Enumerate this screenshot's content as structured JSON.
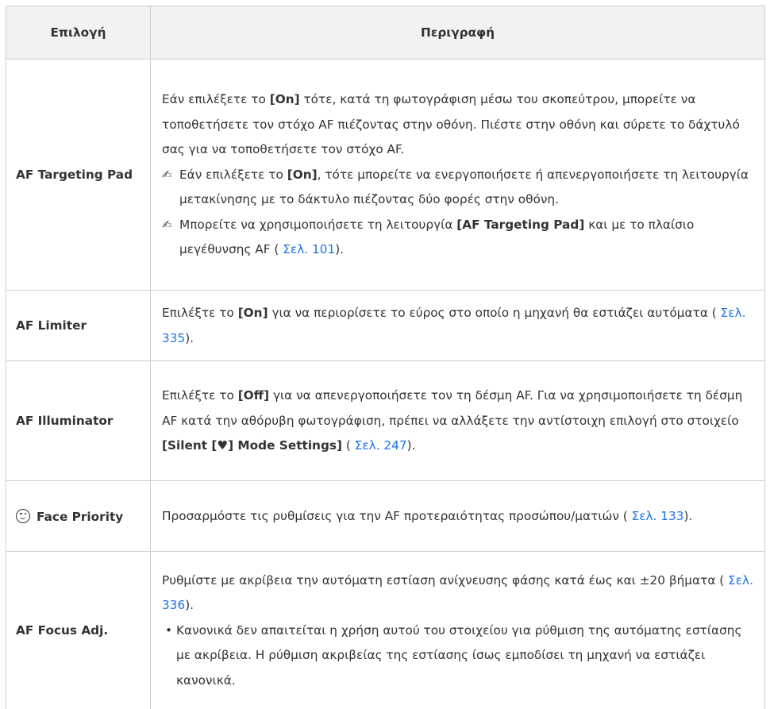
{
  "header": {
    "col_option": "Επιλογή",
    "col_description": "Περιγραφή"
  },
  "rows": [
    {
      "option": "AF Targeting Pad",
      "p1": "Εάν επιλέξετε το ",
      "p1b": "[On]",
      "p1c": " τότε, κατά τη φωτογράφιση μέσω του σκοπεύτρου, μπορείτε να τοποθετήσετε τον στόχο AF πιέζοντας στην οθόνη. Πιέστε στην οθόνη και σύρετε το δάχτυλό σας για να τοποθετήσετε τον στόχο AF.",
      "n1a": "Εάν επιλέξετε το ",
      "n1b": "[On]",
      "n1c": ", τότε μπορείτε να ενεργοποιήσετε ή απενεργοποιήσετε τη λειτουργία μετακίνησης με το δάκτυλο πιέζοντας δύο φορές στην οθόνη.",
      "n2a": "Μπορείτε να χρησιμοποιήσετε τη λειτουργία ",
      "n2b": "[AF Targeting Pad]",
      "n2c": " και με το πλαίσιο μεγέθυνσης AF (",
      "n2link": " Σελ. 101",
      "n2d": ")."
    },
    {
      "option": "AF Limiter",
      "a": "Επιλέξτε το ",
      "b": "[On]",
      "c": " για να περιορίσετε το εύρος στο οποίο η μηχανή θα εστιάζει αυτόματα (",
      "link": " Σελ. 335",
      "d": ")."
    },
    {
      "option": "AF Illuminator",
      "a": "Επιλέξτε το ",
      "b": "[Off]",
      "c": " για να απενεργοποιήσετε τον τη δέσμη AF. Για να χρησιμοποιήσετε τη δέσμη AF κατά την αθόρυβη φωτογράφιση, πρέπει να αλλάξετε την αντίστοιχη επιλογή στο στοιχείο ",
      "b2": "[Silent [♥] Mode Settings]",
      "c2": " (",
      "link": " Σελ. 247",
      "d": ")."
    },
    {
      "option": "Face Priority",
      "icon": "face-smile-icon",
      "a": "Προσαρμόστε τις ρυθμίσεις για την AF προτεραιότητας προσώπου/ματιών (",
      "link": " Σελ. 133",
      "d": ")."
    },
    {
      "option": "AF Focus Adj.",
      "a": "Ρυθμίστε με ακρίβεια την αυτόματη εστίαση ανίχνευσης φάσης κατά έως και ±20 βήματα (",
      "link": " Σελ. 336",
      "d": ").",
      "bullet_symbol": "•",
      "bullet": "Κανονικά δεν απαιτείται η χρήση αυτού του στοιχείου για ρύθμιση της αυτόματης εστίασης με ακρίβεια. Η ρύθμιση ακριβείας της εστίασης ίσως εμποδίσει τη μηχανή να εστιάζει κανονικά."
    }
  ],
  "colors": {
    "link": "#1a73e8",
    "header_bg": "#f2f2f2",
    "border": "#cfcfcf",
    "text": "#333333"
  }
}
